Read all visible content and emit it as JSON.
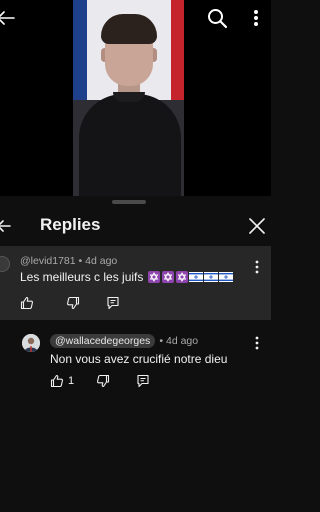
{
  "panel": {
    "title": "Replies"
  },
  "parent_comment": {
    "author": "@levid1781",
    "time": "4d ago",
    "text": "Les meilleurs c les juifs",
    "emojis": [
      "star-of-david",
      "star-of-david",
      "star-of-david",
      "flag-israel",
      "flag-israel",
      "flag-israel"
    ]
  },
  "reply": {
    "mention": "@wallacedegeorges",
    "time": "4d ago",
    "text": "Non vous avez crucifié notre dieu",
    "like_count": "1"
  },
  "separator": "•",
  "icons": {
    "back": "arrow-left-icon",
    "search": "search-icon",
    "more": "more-vert-icon",
    "close": "close-icon",
    "like": "thumb-up-icon",
    "dislike": "thumb-down-icon",
    "reply": "reply-icon"
  },
  "colors": {
    "background": "#0f0f0f",
    "highlight": "#272727",
    "text": "#f1f1f1",
    "meta": "#aaaaaa",
    "chip": "#3b3b3b"
  }
}
